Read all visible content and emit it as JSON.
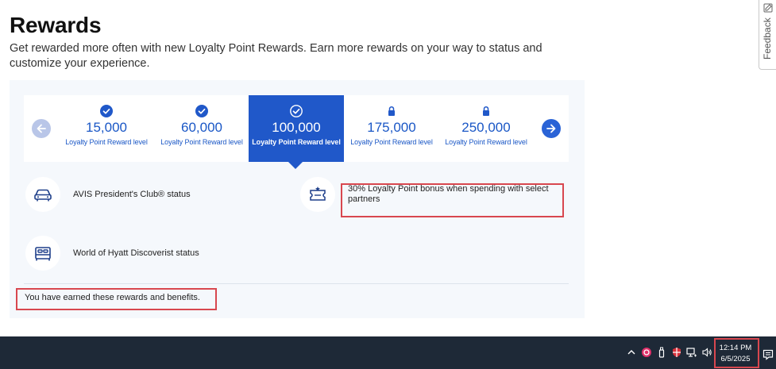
{
  "header": {
    "title": "Rewards",
    "subtitle": "Get rewarded more often with new Loyalty Point Rewards. Earn more rewards on your way to status and customize your experience."
  },
  "feedback": {
    "label": "Feedback"
  },
  "levels": [
    {
      "amount": "15,000",
      "label": "Loyalty Point Reward level",
      "state": "earned"
    },
    {
      "amount": "60,000",
      "label": "Loyalty Point Reward level",
      "state": "earned"
    },
    {
      "amount": "100,000",
      "label": "Loyalty Point Reward level",
      "state": "selected"
    },
    {
      "amount": "175,000",
      "label": "Loyalty Point Reward level",
      "state": "locked"
    },
    {
      "amount": "250,000",
      "label": "Loyalty Point Reward level",
      "state": "locked"
    }
  ],
  "benefits": [
    {
      "text": "AVIS President's Club® status",
      "icon": "car-icon"
    },
    {
      "text": "World of Hyatt Discoverist status",
      "icon": "bed-icon"
    },
    {
      "text": "30% Loyalty Point bonus when spending with select partners",
      "icon": "ticket-icon"
    }
  ],
  "footer_note": "You have earned these rewards and benefits.",
  "taskbar": {
    "time": "12:14 PM",
    "date": "6/5/2025"
  },
  "colors": {
    "accent": "#2058c9",
    "link": "#1a57c6",
    "highlight": "#d8474f",
    "taskbar": "#1e2937"
  }
}
